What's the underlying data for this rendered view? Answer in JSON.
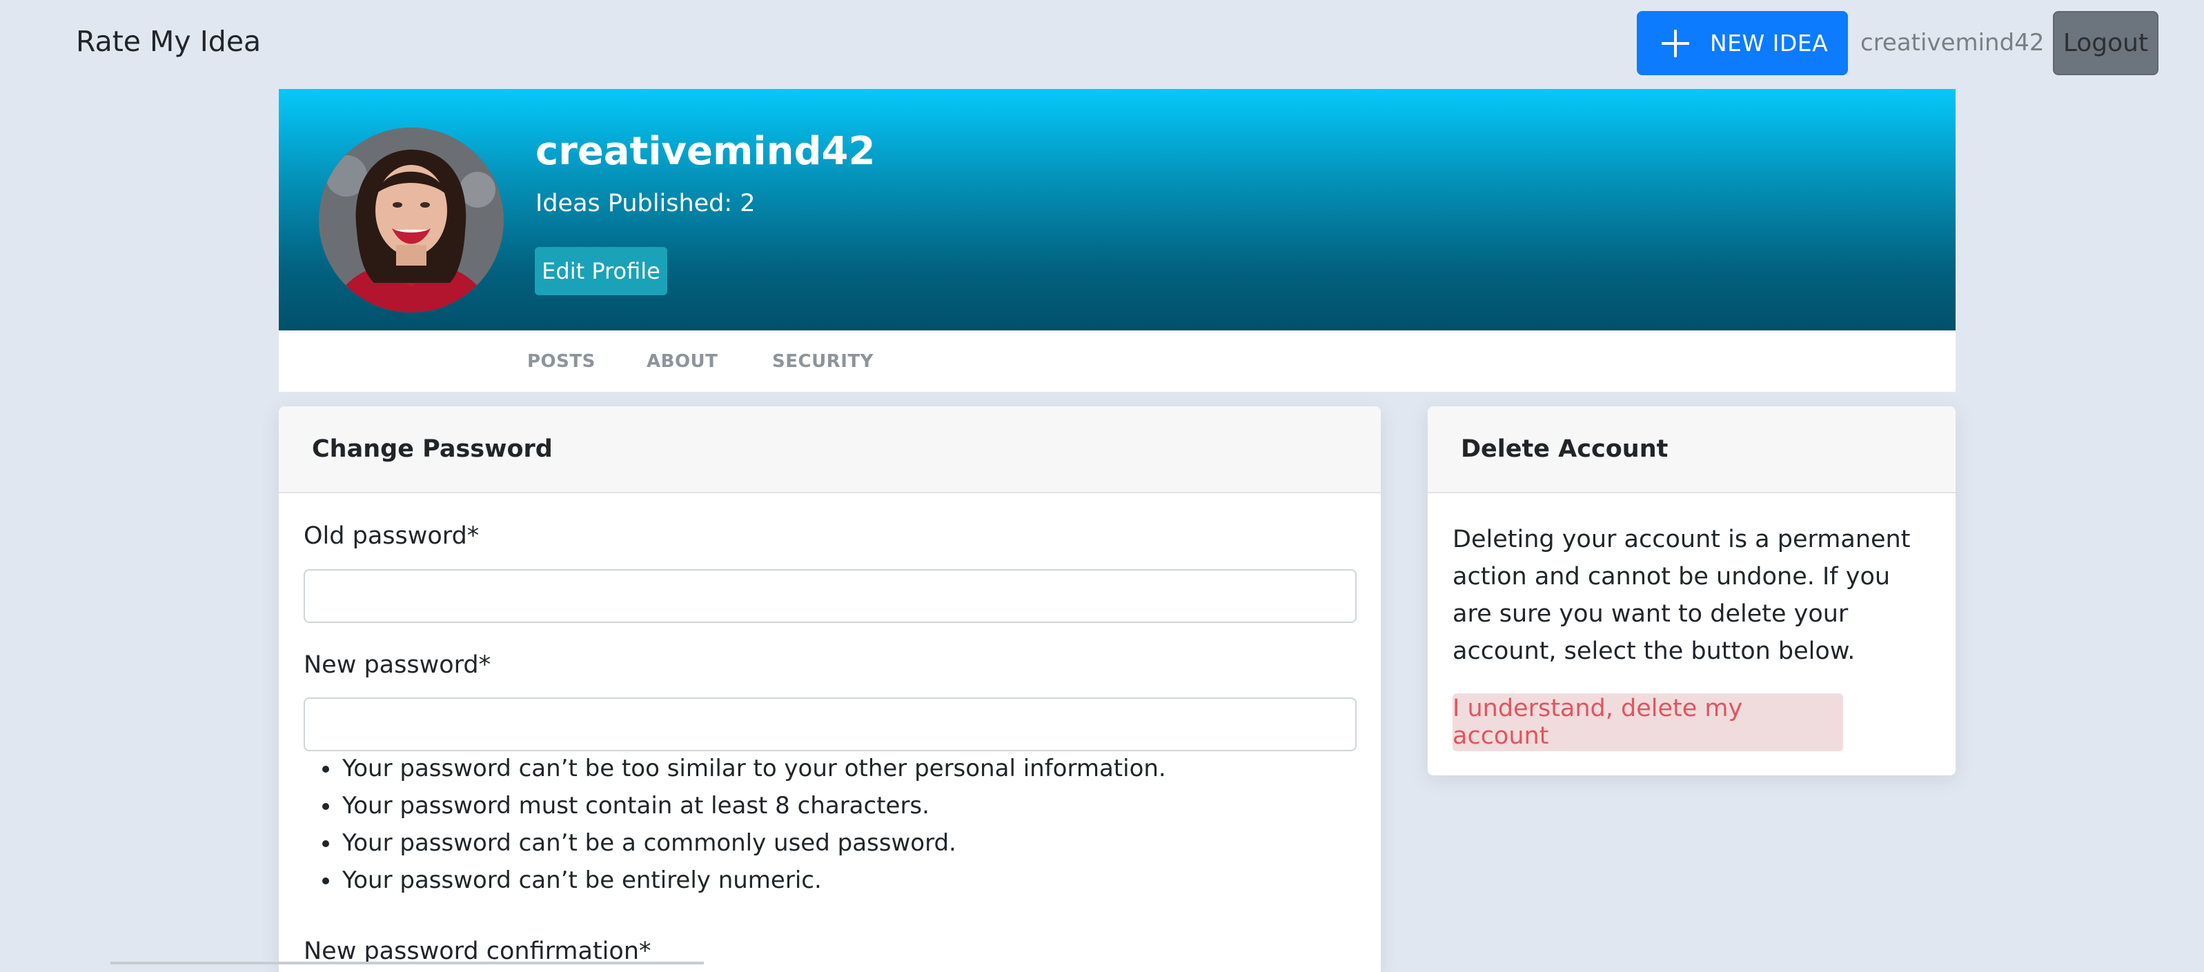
{
  "navbar": {
    "brand": "Rate My Idea",
    "new_idea_label": "NEW IDEA",
    "username": "creativemind42",
    "logout_label": "Logout"
  },
  "profile": {
    "name": "creativemind42",
    "stats": "Ideas Published: 2",
    "edit_label": "Edit Profile"
  },
  "tabs": [
    {
      "label": "POSTS"
    },
    {
      "label": "ABOUT"
    },
    {
      "label": "SECURITY"
    }
  ],
  "change_password": {
    "title": "Change Password",
    "old_label": "Old password*",
    "old_value": "",
    "new_label": "New password*",
    "new_value": "",
    "help": [
      "Your password can’t be too similar to your other personal information.",
      "Your password must contain at least 8 characters.",
      "Your password can’t be a commonly used password.",
      "Your password can’t be entirely numeric."
    ],
    "confirm_label": "New password confirmation*"
  },
  "delete_account": {
    "title": "Delete Account",
    "description": "Deleting your account is a permanent action and cannot be undone. If you are sure you want to delete your account, select the button below.",
    "button_label": "I understand, delete my account"
  },
  "colors": {
    "primary": "#0d7bfe",
    "secondary": "#6c757d",
    "info": "#1aa2b8",
    "danger_text": "#e0555f",
    "danger_bg": "#f1dcdd",
    "header_gradient_top": "#05c9fb",
    "header_gradient_bottom": "#01506a",
    "page_background": "#e1e7f0"
  },
  "icons": {
    "new_idea": "plus-icon"
  }
}
